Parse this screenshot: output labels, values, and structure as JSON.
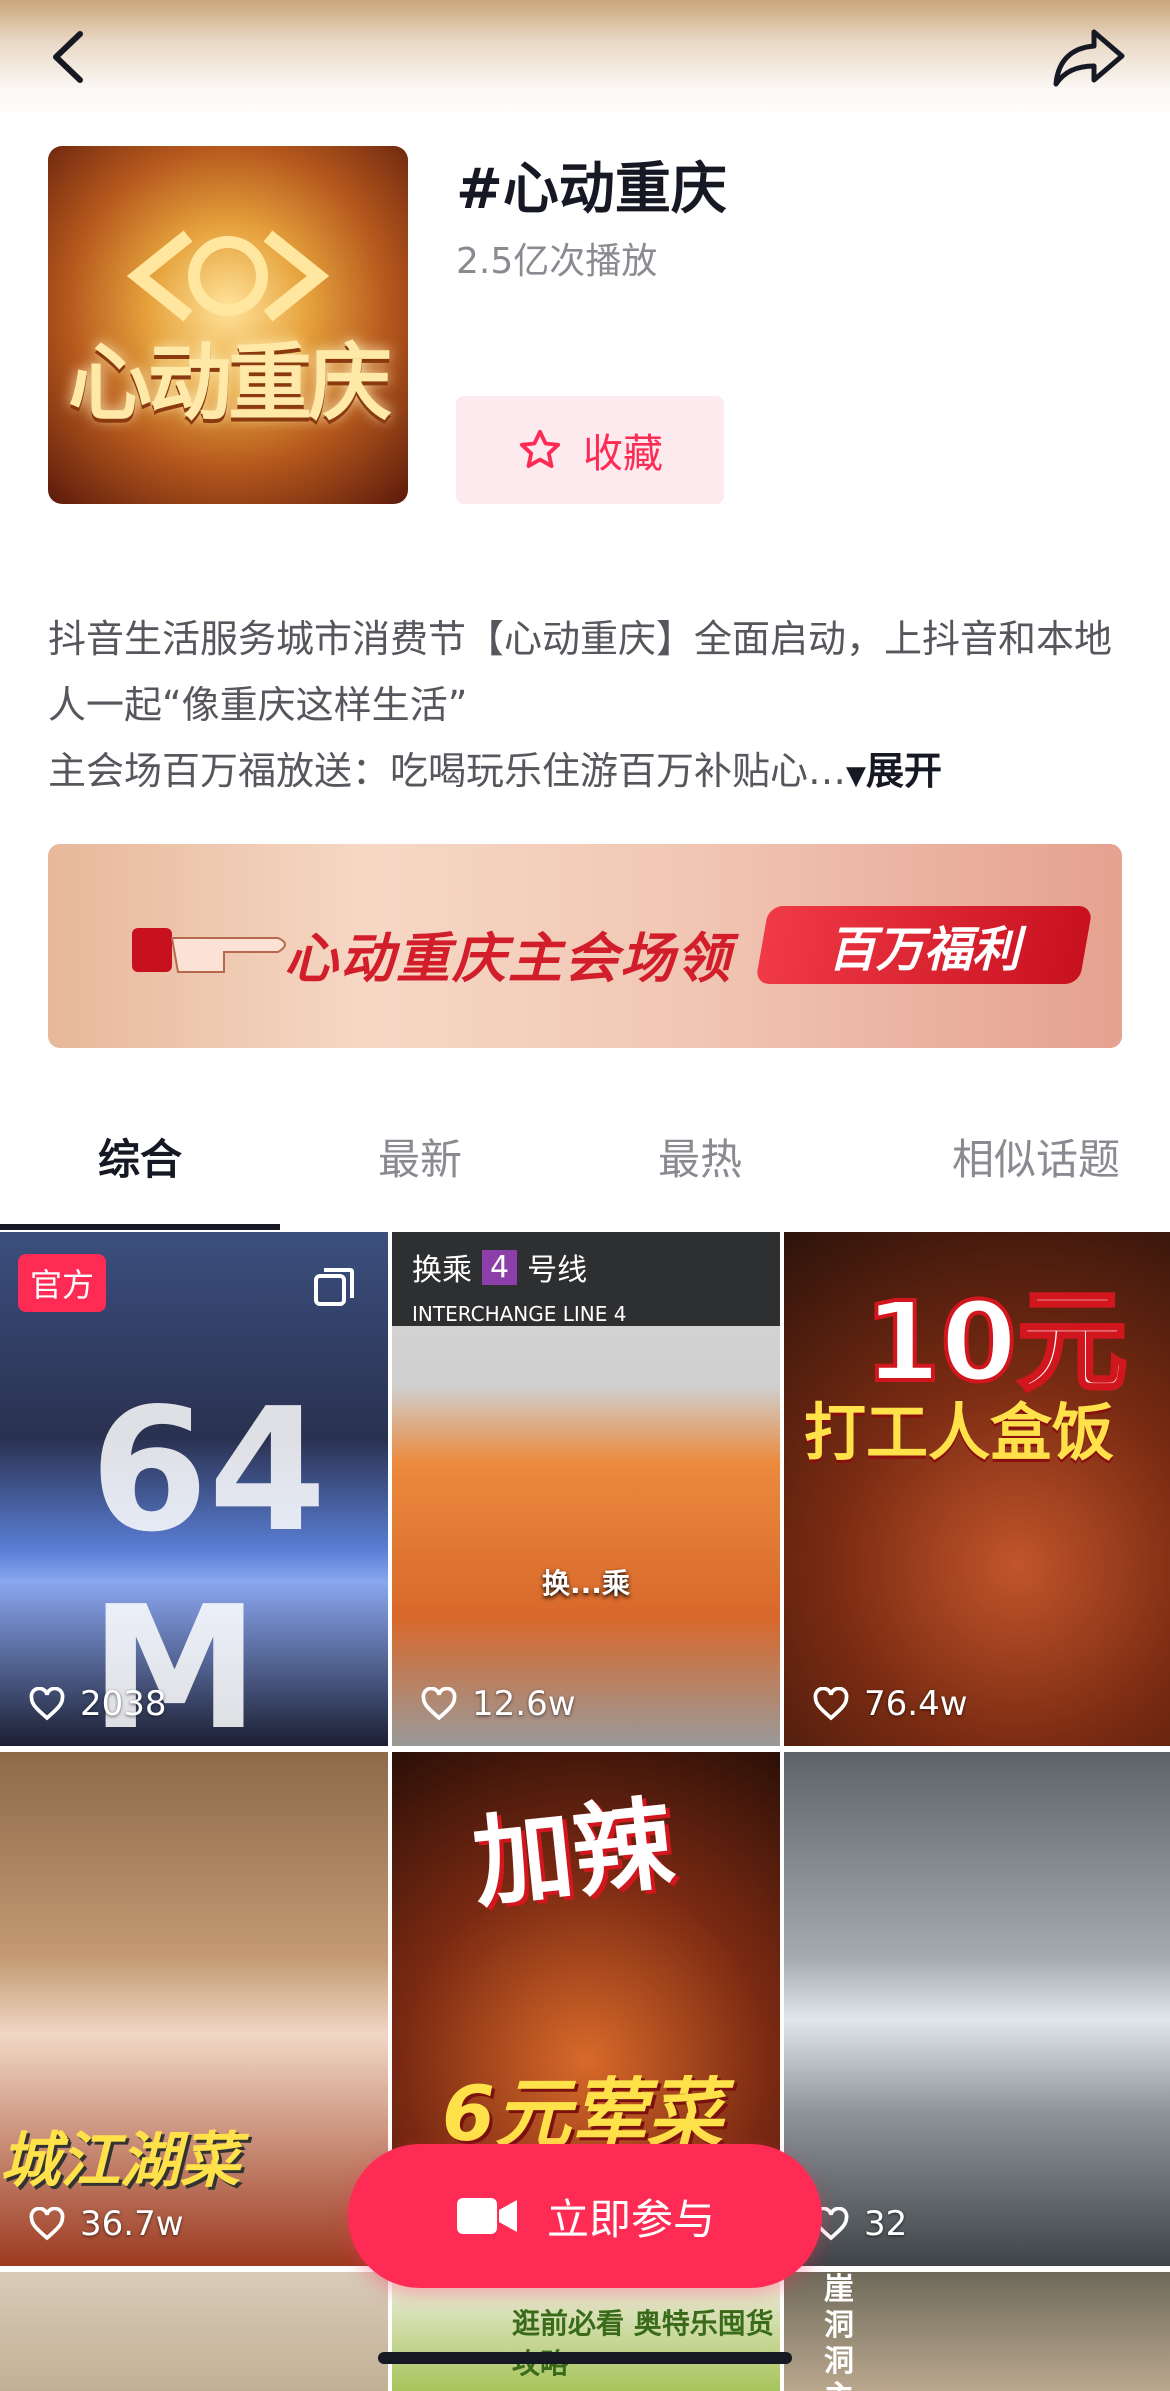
{
  "topbar": {
    "back_icon": "chevron-left-icon",
    "share_icon": "share-arrow-icon"
  },
  "header": {
    "cover_text": "心动重庆",
    "title": "#心动重庆",
    "plays": "2.5亿次播放",
    "favorite_label": "收藏",
    "favorite_icon": "star-outline-icon"
  },
  "description": {
    "line1": "抖音生活服务城市消费节【心动重庆】全面启动，上抖音和本地人一起“像重庆这样生活”",
    "line2": "主会场百万福放送：吃喝玩乐住游百万补贴心…",
    "expand_label": "展开"
  },
  "banner": {
    "text": "心动重庆主会场领",
    "pill": "百万福利"
  },
  "tabs": [
    {
      "label": "综合",
      "active": true
    },
    {
      "label": "最新",
      "active": false
    },
    {
      "label": "最热",
      "active": false
    },
    {
      "label": "相似话题",
      "active": false
    }
  ],
  "videos": [
    {
      "likes": "2038",
      "badge": "官方",
      "overlay": "64 M",
      "multi": true
    },
    {
      "likes": "12.6w",
      "sign": "换乘",
      "sign_num": "4",
      "sign_line": "号线",
      "sign_en": "INTERCHANGE  LINE 4",
      "caption": "换...乘"
    },
    {
      "likes": "76.4w",
      "overlay1": "10元",
      "overlay2": "打工人盒饭"
    },
    {
      "likes": "36.7w",
      "overlay1": "城江湖菜"
    },
    {
      "likes": "",
      "overlay1": "加辣",
      "overlay2": "6元荤菜"
    },
    {
      "likes": "32"
    },
    {
      "likes": ""
    },
    {
      "likes": "",
      "caption": "逛前必看 奥特乐囤货攻略"
    },
    {
      "likes": "",
      "caption": "崖洞洞主"
    }
  ],
  "join_button": {
    "label": "立即参与",
    "icon": "video-camera-icon"
  },
  "colors": {
    "accent": "#fe2c55",
    "text": "#161823",
    "muted": "#8a8b91"
  }
}
